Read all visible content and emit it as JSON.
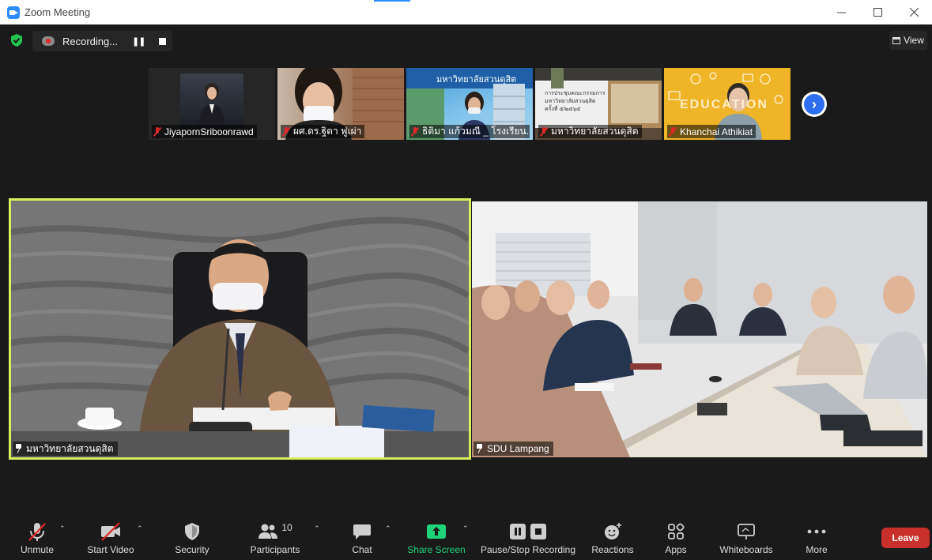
{
  "window": {
    "title": "Zoom Meeting"
  },
  "top_bar": {
    "recording_status": "Recording...",
    "view_label": "View"
  },
  "thumbnails": [
    {
      "name": "JiyapornSriboonrawd",
      "muted": true
    },
    {
      "name": "ผศ.ดร.ฐิตา ฟูเผ่า",
      "muted": true
    },
    {
      "name": "ธิติมา แก้วมณี _ โรงเรียน...",
      "muted": true
    },
    {
      "name": "มหาวิทยาลัยสวนดุสิต",
      "muted": true
    },
    {
      "name": "Khanchai Athikiat",
      "muted": true
    }
  ],
  "thumb_texts": {
    "t3_banner": "มหาวิทยาลัยสวนดุสิต",
    "t4_slide_line1": "การประชุมคณะกรรมการ",
    "t4_slide_line2": "มหาวิทยาลัยสวนดุสิต",
    "t4_slide_line3": "ครั้งที่ ๕/๒๕๖๕",
    "t5_text": "EDUCATION"
  },
  "main_videos": [
    {
      "name": "มหาวิทยาลัยสวนดุสิต",
      "active_speaker": true
    },
    {
      "name": "SDU Lampang",
      "active_speaker": false
    }
  ],
  "toolbar": {
    "unmute": "Unmute",
    "start_video": "Start Video",
    "security": "Security",
    "participants": "Participants",
    "participants_count": "10",
    "chat": "Chat",
    "share_screen": "Share Screen",
    "pause_stop_recording": "Pause/Stop Recording",
    "reactions": "Reactions",
    "apps": "Apps",
    "whiteboards": "Whiteboards",
    "more": "More",
    "leave": "Leave"
  },
  "colors": {
    "active_speaker_border": "#d6f05c",
    "share_green": "#1fd37a",
    "leave_red": "#c9302c",
    "muted_red": "#e02828",
    "accent_blue": "#2d8cff"
  }
}
